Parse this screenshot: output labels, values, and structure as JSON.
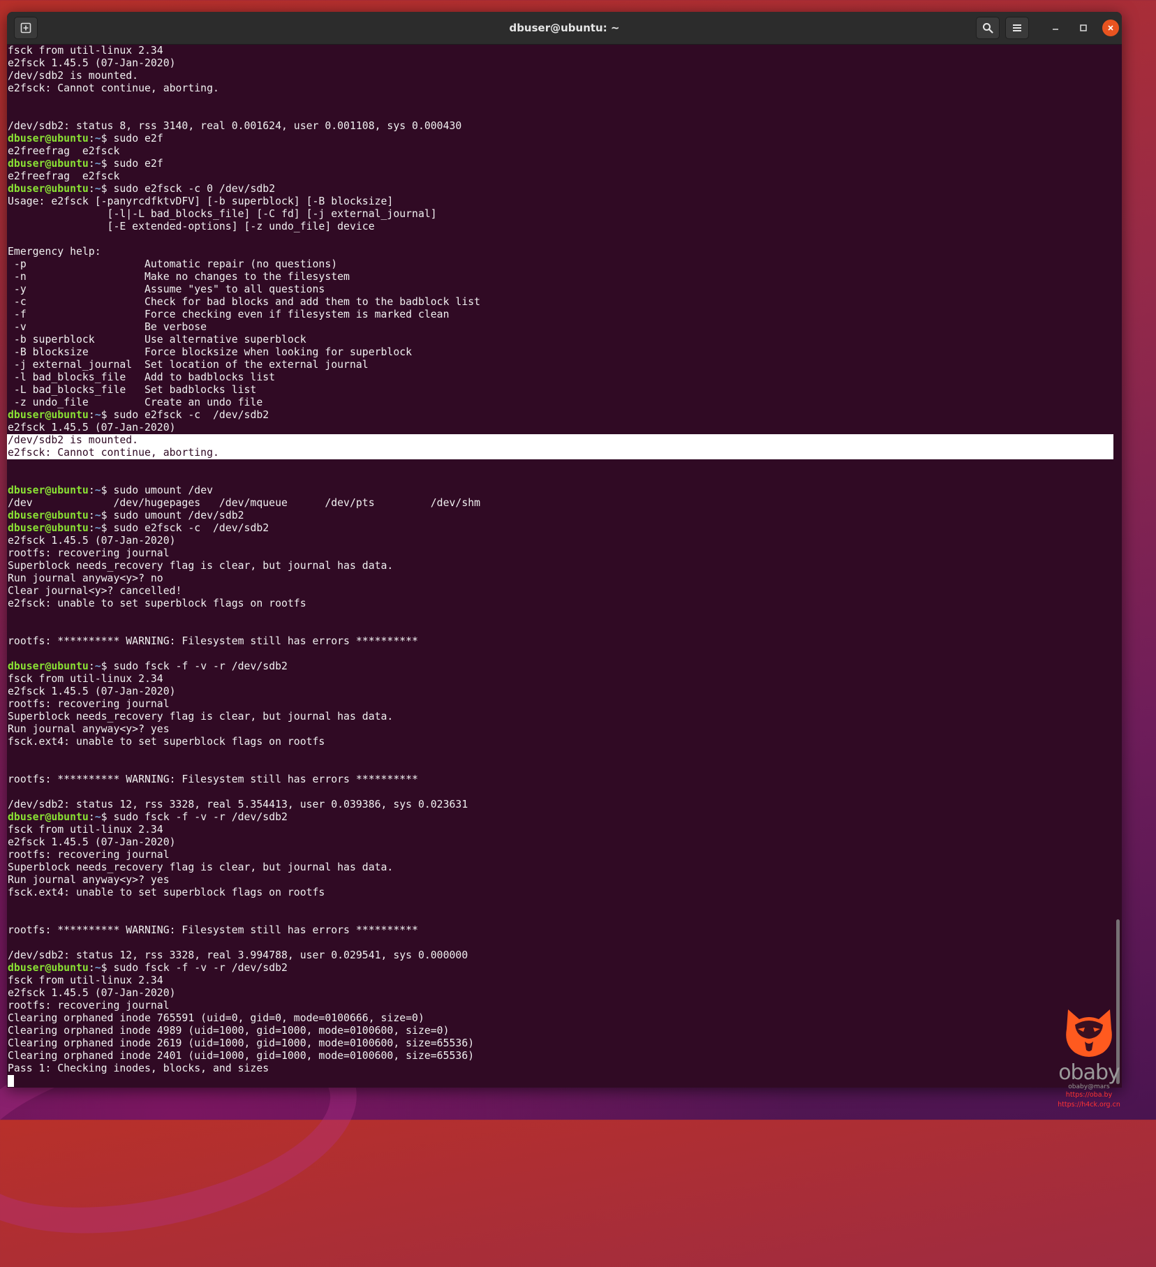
{
  "window": {
    "title": "dbuser@ubuntu: ~",
    "accent_close": "#e95420",
    "bg": "#300a24"
  },
  "icons": {
    "new_tab": "new-tab-icon",
    "search": "search-icon",
    "menu": "hamburger-menu-icon",
    "minimize": "minimize-icon",
    "maximize": "maximize-icon",
    "close": "close-icon"
  },
  "prompt": {
    "user": "dbuser@ubuntu",
    "path": "~"
  },
  "lines": [
    {
      "t": "fsck from util-linux 2.34"
    },
    {
      "t": "e2fsck 1.45.5 (07-Jan-2020)"
    },
    {
      "t": "/dev/sdb2 is mounted."
    },
    {
      "t": "e2fsck: Cannot continue, aborting."
    },
    {
      "t": ""
    },
    {
      "t": ""
    },
    {
      "t": "/dev/sdb2: status 8, rss 3140, real 0.001624, user 0.001108, sys 0.000430"
    },
    {
      "cmd": "sudo e2f"
    },
    {
      "t": "e2freefrag  e2fsck"
    },
    {
      "cmd": "sudo e2f"
    },
    {
      "t": "e2freefrag  e2fsck"
    },
    {
      "cmd": "sudo e2fsck -c 0 /dev/sdb2"
    },
    {
      "t": "Usage: e2fsck [-panyrcdfktvDFV] [-b superblock] [-B blocksize]"
    },
    {
      "t": "                [-l|-L bad_blocks_file] [-C fd] [-j external_journal]"
    },
    {
      "t": "                [-E extended-options] [-z undo_file] device"
    },
    {
      "t": ""
    },
    {
      "t": "Emergency help:"
    },
    {
      "t": " -p                   Automatic repair (no questions)"
    },
    {
      "t": " -n                   Make no changes to the filesystem"
    },
    {
      "t": " -y                   Assume \"yes\" to all questions"
    },
    {
      "t": " -c                   Check for bad blocks and add them to the badblock list"
    },
    {
      "t": " -f                   Force checking even if filesystem is marked clean"
    },
    {
      "t": " -v                   Be verbose"
    },
    {
      "t": " -b superblock        Use alternative superblock"
    },
    {
      "t": " -B blocksize         Force blocksize when looking for superblock"
    },
    {
      "t": " -j external_journal  Set location of the external journal"
    },
    {
      "t": " -l bad_blocks_file   Add to badblocks list"
    },
    {
      "t": " -L bad_blocks_file   Set badblocks list"
    },
    {
      "t": " -z undo_file         Create an undo file"
    },
    {
      "cmd": "sudo e2fsck -c  /dev/sdb2"
    },
    {
      "t": "e2fsck 1.45.5 (07-Jan-2020)"
    },
    {
      "t": "/dev/sdb2 is mounted.",
      "sel": true
    },
    {
      "t": "e2fsck: Cannot continue, aborting.",
      "sel": true
    },
    {
      "t": ""
    },
    {
      "t": ""
    },
    {
      "cmd": "sudo umount /dev"
    },
    {
      "t": "/dev             /dev/hugepages   /dev/mqueue      /dev/pts         /dev/shm"
    },
    {
      "cmd": "sudo umount /dev/sdb2"
    },
    {
      "cmd": "sudo e2fsck -c  /dev/sdb2"
    },
    {
      "t": "e2fsck 1.45.5 (07-Jan-2020)"
    },
    {
      "t": "rootfs: recovering journal"
    },
    {
      "t": "Superblock needs_recovery flag is clear, but journal has data."
    },
    {
      "t": "Run journal anyway<y>? no"
    },
    {
      "t": "Clear journal<y>? cancelled!"
    },
    {
      "t": "e2fsck: unable to set superblock flags on rootfs"
    },
    {
      "t": ""
    },
    {
      "t": ""
    },
    {
      "t": "rootfs: ********** WARNING: Filesystem still has errors **********"
    },
    {
      "t": ""
    },
    {
      "cmd": "sudo fsck -f -v -r /dev/sdb2"
    },
    {
      "t": "fsck from util-linux 2.34"
    },
    {
      "t": "e2fsck 1.45.5 (07-Jan-2020)"
    },
    {
      "t": "rootfs: recovering journal"
    },
    {
      "t": "Superblock needs_recovery flag is clear, but journal has data."
    },
    {
      "t": "Run journal anyway<y>? yes"
    },
    {
      "t": "fsck.ext4: unable to set superblock flags on rootfs"
    },
    {
      "t": ""
    },
    {
      "t": ""
    },
    {
      "t": "rootfs: ********** WARNING: Filesystem still has errors **********"
    },
    {
      "t": ""
    },
    {
      "t": "/dev/sdb2: status 12, rss 3328, real 5.354413, user 0.039386, sys 0.023631"
    },
    {
      "cmd": "sudo fsck -f -v -r /dev/sdb2"
    },
    {
      "t": "fsck from util-linux 2.34"
    },
    {
      "t": "e2fsck 1.45.5 (07-Jan-2020)"
    },
    {
      "t": "rootfs: recovering journal"
    },
    {
      "t": "Superblock needs_recovery flag is clear, but journal has data."
    },
    {
      "t": "Run journal anyway<y>? yes"
    },
    {
      "t": "fsck.ext4: unable to set superblock flags on rootfs"
    },
    {
      "t": ""
    },
    {
      "t": ""
    },
    {
      "t": "rootfs: ********** WARNING: Filesystem still has errors **********"
    },
    {
      "t": ""
    },
    {
      "t": "/dev/sdb2: status 12, rss 3328, real 3.994788, user 0.029541, sys 0.000000"
    },
    {
      "cmd": "sudo fsck -f -v -r /dev/sdb2"
    },
    {
      "t": "fsck from util-linux 2.34"
    },
    {
      "t": "e2fsck 1.45.5 (07-Jan-2020)"
    },
    {
      "t": "rootfs: recovering journal"
    },
    {
      "t": "Clearing orphaned inode 765591 (uid=0, gid=0, mode=0100666, size=0)"
    },
    {
      "t": "Clearing orphaned inode 4989 (uid=1000, gid=1000, mode=0100600, size=0)"
    },
    {
      "t": "Clearing orphaned inode 2619 (uid=1000, gid=1000, mode=0100600, size=65536)"
    },
    {
      "t": "Clearing orphaned inode 2401 (uid=1000, gid=1000, mode=0100600, size=65536)"
    },
    {
      "t": "Pass 1: Checking inodes, blocks, and sizes"
    },
    {
      "cursor": true
    }
  ],
  "watermark": {
    "brand": "obaby",
    "handle": "obaby@mars",
    "link1": "https://oba.by",
    "link2": "https://h4ck.org.cn",
    "color": "#ff5a1f"
  }
}
